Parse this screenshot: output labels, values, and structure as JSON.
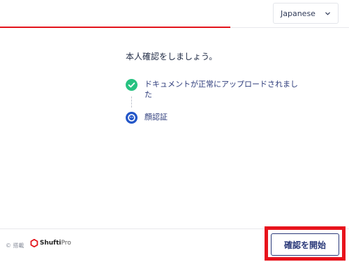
{
  "header": {
    "language": "Japanese"
  },
  "main": {
    "title": "本人確認をしましょう。",
    "steps": [
      {
        "label": "ドキュメントが正常にアップロードされました",
        "status": "completed",
        "icon": "check-circle-icon"
      },
      {
        "label": "顔認証",
        "status": "current",
        "icon": "face-scan-icon"
      }
    ]
  },
  "footer": {
    "powered_by": "© 搭載",
    "brand_shufti": "Shufti",
    "brand_pro": "Pro",
    "start_button": "確認を開始"
  },
  "colors": {
    "accent": "#2b3a7a",
    "progress": "#e3141b",
    "success": "#27c281",
    "highlight": "#e8131c"
  }
}
